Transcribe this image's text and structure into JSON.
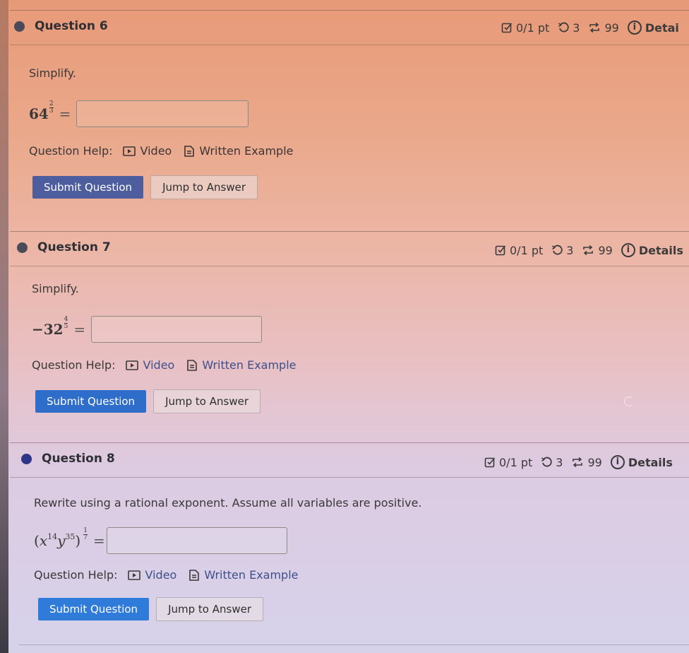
{
  "questions": [
    {
      "title": "Question 6",
      "score": "0/1 pt",
      "retries": "3",
      "attempts": "99",
      "details_label": "Detai",
      "prompt": "Simplify.",
      "math": {
        "base": "64",
        "exp_num": "2",
        "exp_den": "3",
        "equals": "="
      },
      "answer_value": "",
      "help_label": "Question Help:",
      "video_label": "Video",
      "written_label": "Written Example",
      "submit_label": "Submit Question",
      "jump_label": "Jump to Answer"
    },
    {
      "title": "Question 7",
      "score": "0/1 pt",
      "retries": "3",
      "attempts": "99",
      "details_label": "Details",
      "prompt": "Simplify.",
      "math": {
        "base": "−32",
        "exp_num": "4",
        "exp_den": "5",
        "equals": "="
      },
      "answer_value": "",
      "help_label": "Question Help:",
      "video_label": "Video",
      "written_label": "Written Example",
      "submit_label": "Submit Question",
      "jump_label": "Jump to Answer"
    },
    {
      "title": "Question 8",
      "score": "0/1 pt",
      "retries": "3",
      "attempts": "99",
      "details_label": "Details",
      "prompt": "Rewrite using a rational exponent. Assume all variables are positive.",
      "math": {
        "open": "(",
        "x": "x",
        "x_exp": "14",
        "y": "y",
        "y_exp": "35",
        "close": ")",
        "exp_num": "1",
        "exp_den": "7",
        "equals": "="
      },
      "answer_value": "",
      "help_label": "Question Help:",
      "video_label": "Video",
      "written_label": "Written Example",
      "submit_label": "Submit Question",
      "jump_label": "Jump to Answer"
    }
  ],
  "icons": {
    "score": "checkbox-icon",
    "retries": "undo-icon",
    "attempts": "repeat-icon",
    "details": "info-icon",
    "video": "video-icon",
    "written": "document-icon"
  },
  "colors": {
    "submit_blue": "#2f7bd9",
    "link_blue": "#3f4f8a",
    "bullet_q8": "#2d3588"
  }
}
